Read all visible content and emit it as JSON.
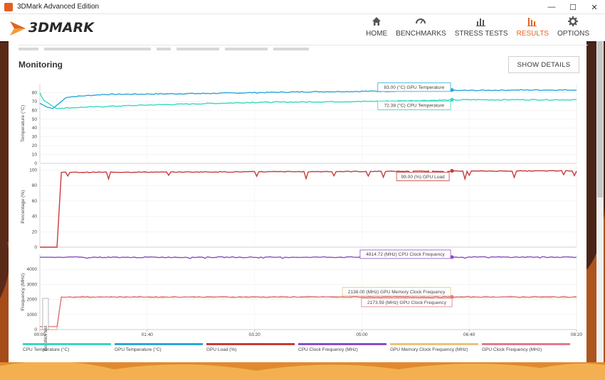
{
  "window": {
    "title": "3DMark Advanced Edition",
    "buttons": {
      "minimize": "—",
      "maximize": "☐",
      "close": "✕"
    }
  },
  "header": {
    "logo_text": "3DMARK",
    "nav": [
      {
        "label": "HOME",
        "icon": "home-icon"
      },
      {
        "label": "BENCHMARKS",
        "icon": "gauge-icon"
      },
      {
        "label": "STRESS TESTS",
        "icon": "bars-icon"
      },
      {
        "label": "RESULTS",
        "icon": "results-icon",
        "active": true
      },
      {
        "label": "OPTIONS",
        "icon": "gear-icon"
      }
    ],
    "accent": "#e3641e"
  },
  "main": {
    "section_title": "Monitoring",
    "show_details": "SHOW DETAILS",
    "graphics_test_label": "Graphics test"
  },
  "chart_data": {
    "type": "line",
    "x_ticks": [
      "00:00",
      "01:40",
      "03:20",
      "05:00",
      "06:40",
      "08:20"
    ],
    "x_range_seconds": [
      0,
      500
    ],
    "panels": [
      {
        "ylabel": "Temperature (°C)",
        "yticks": [
          0,
          10,
          20,
          30,
          40,
          50,
          60,
          70,
          80
        ],
        "ylim": [
          0,
          90
        ],
        "series": [
          {
            "name": "GPU Temperature (°C)",
            "color": "#2aa7dc",
            "points": [
              [
                0,
                68
              ],
              [
                6,
                64
              ],
              [
                12,
                62
              ],
              [
                25,
                75
              ],
              [
                60,
                78
              ],
              [
                150,
                79
              ],
              [
                250,
                81
              ],
              [
                350,
                82
              ],
              [
                450,
                83
              ],
              [
                500,
                83
              ]
            ]
          },
          {
            "name": "CPU Temperature (°C)",
            "color": "#35d9c2",
            "points": [
              [
                0,
                80
              ],
              [
                3,
                72
              ],
              [
                8,
                68
              ],
              [
                15,
                62
              ],
              [
                30,
                63
              ],
              [
                100,
                66
              ],
              [
                200,
                69
              ],
              [
                300,
                70
              ],
              [
                400,
                72
              ],
              [
                500,
                72
              ]
            ]
          }
        ],
        "tooltips": [
          {
            "text": "83.00 (°C) GPU Temperature",
            "series": 0,
            "t": 384
          },
          {
            "text": "72.38 (°C) CPU Temperature",
            "series": 1,
            "t": 384
          }
        ]
      },
      {
        "ylabel": "Percentage (%)",
        "yticks": [
          0,
          20,
          40,
          60,
          80,
          100
        ],
        "ylim": [
          0,
          105
        ],
        "series": [
          {
            "name": "GPU Load (%)",
            "color": "#c93a3a",
            "points": [
              [
                0,
                0
              ],
              [
                17,
                0
              ],
              [
                19,
                97
              ],
              [
                500,
                99
              ]
            ]
          }
        ],
        "tooltips": [
          {
            "text": "99.00 (%) GPU Load",
            "series": 0,
            "t": 384
          }
        ]
      },
      {
        "ylabel": "Frequency (MHz)",
        "yticks": [
          0,
          1000,
          2000,
          3000,
          4000
        ],
        "ylim": [
          0,
          5000
        ],
        "series": [
          {
            "name": "CPU Clock Frequency (MHz)",
            "color": "#8a4fc4",
            "points": [
              [
                0,
                4800
              ],
              [
                500,
                4814
              ]
            ]
          },
          {
            "name": "GPU Memory Clock Frequency (MHz)",
            "color": "#e8c47a",
            "points": [
              [
                0,
                0
              ],
              [
                17,
                0
              ],
              [
                19,
                2138
              ],
              [
                500,
                2138
              ]
            ]
          },
          {
            "name": "GPU Clock Frequency (MHz)",
            "color": "#e07a8a",
            "points": [
              [
                0,
                200
              ],
              [
                17,
                200
              ],
              [
                19,
                2170
              ],
              [
                500,
                2173
              ]
            ]
          }
        ],
        "tooltips": [
          {
            "text": "4814.72 (MHz) CPU Clock Frequency",
            "series": 0,
            "t": 384
          },
          {
            "text": "2138.00 (MHz) GPU Memory Clock Frequency",
            "series": 1,
            "t": 384
          },
          {
            "text": "2173.59 (MHz) GPU Clock Frequency",
            "series": 2,
            "t": 384
          }
        ]
      }
    ],
    "legend": [
      {
        "label": "CPU Temperature (°C)",
        "color": "#35d9c2"
      },
      {
        "label": "GPU Temperature (°C)",
        "color": "#2aa7dc"
      },
      {
        "label": "GPU Load (%)",
        "color": "#c93a3a"
      },
      {
        "label": "CPU Clock Frequency (MHz)",
        "color": "#8a4fc4"
      },
      {
        "label": "GPU Memory Clock Frequency (MHz)",
        "color": "#e8c47a"
      },
      {
        "label": "GPU Clock Frequency (MHz)",
        "color": "#e07a8a"
      }
    ]
  }
}
